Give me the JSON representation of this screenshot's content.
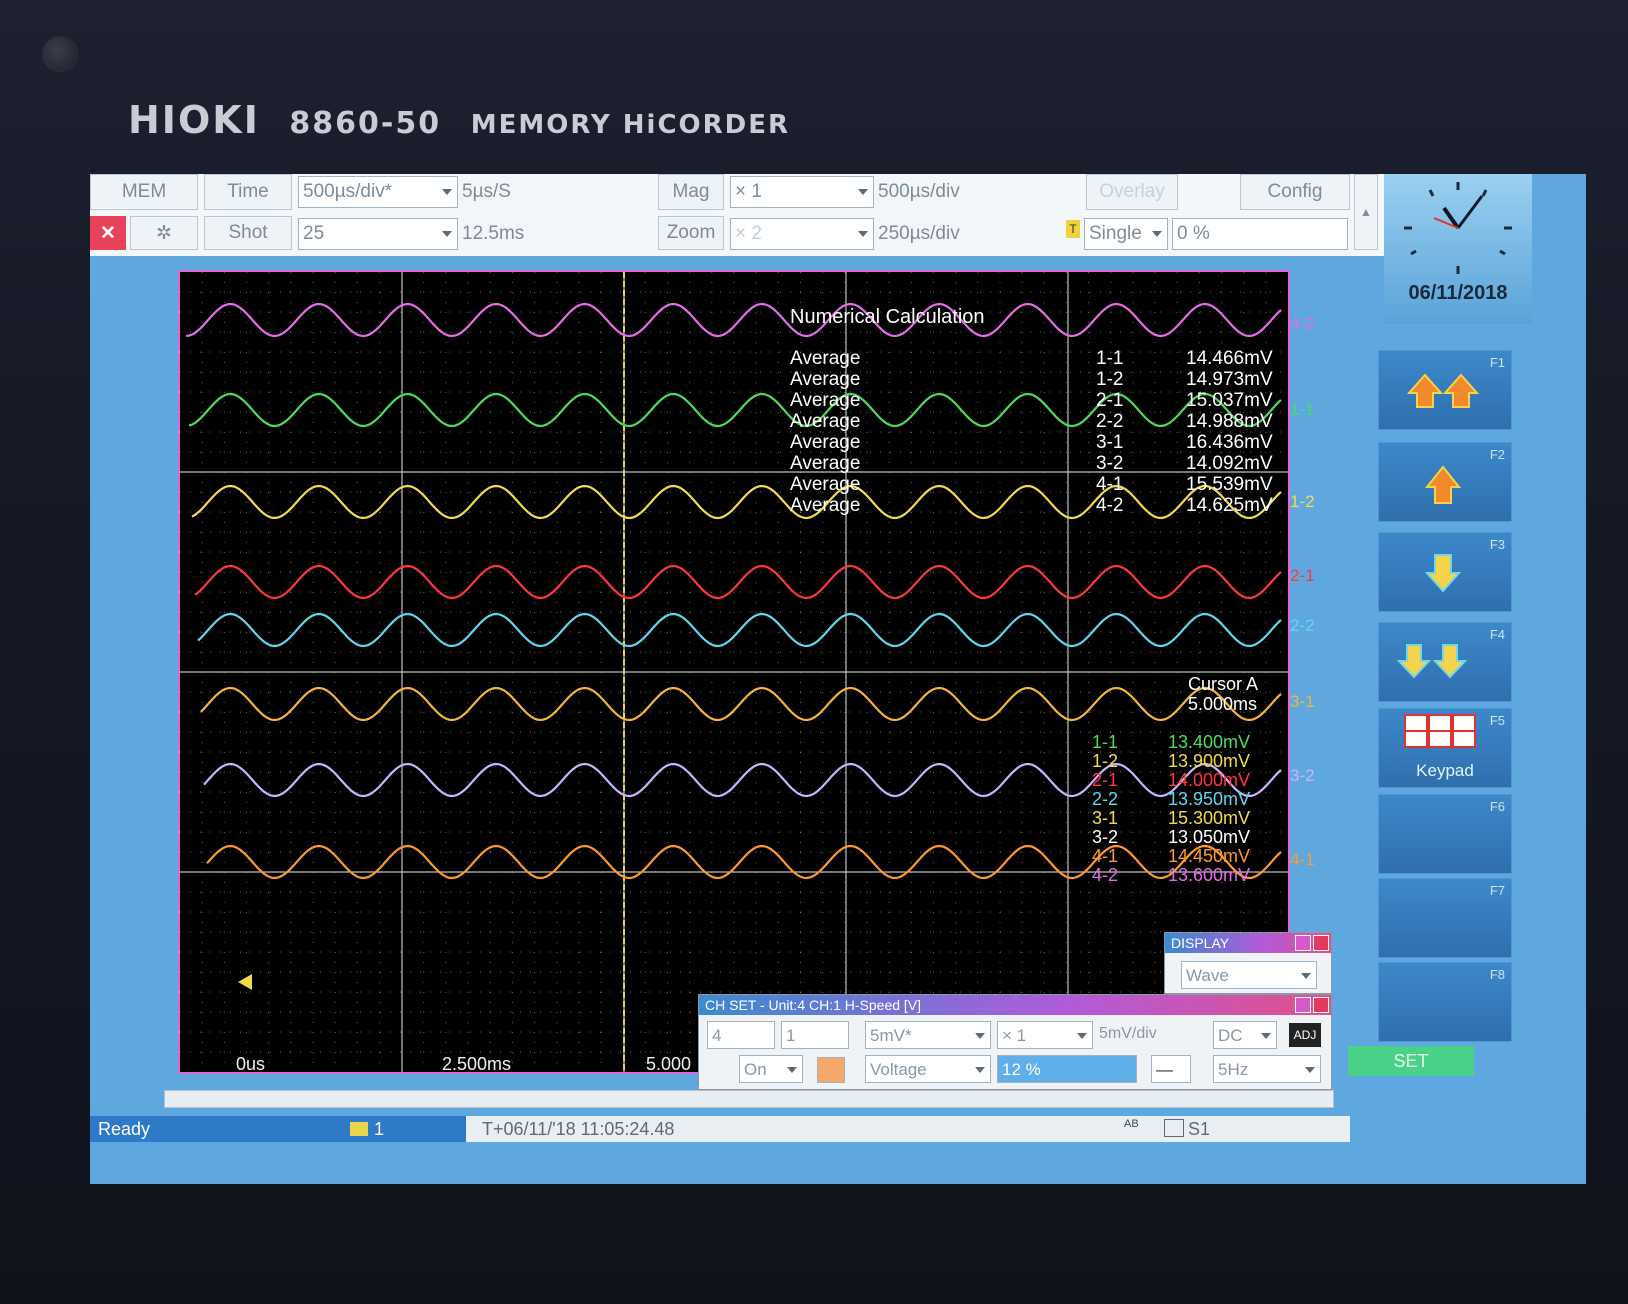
{
  "brand": {
    "name": "HIOKI",
    "model": "8860-50",
    "product": "MEMORY HiCORDER"
  },
  "toolbar": {
    "mem": "MEM",
    "time_label": "Time",
    "time_value": "500µs/div*",
    "sample_rate": "5µs/S",
    "mag_label": "Mag",
    "mag_value": "× 1",
    "mag_div": "500µs/div",
    "overlay": "Overlay",
    "config": "Config",
    "shot_label": "Shot",
    "shot_value": "25",
    "shot_length": "12.5ms",
    "zoom_label": "Zoom",
    "zoom_value": "× 2",
    "zoom_div": "250µs/div",
    "trigger_mode": "Single",
    "pretrigger": "0 %",
    "trigger_icon": "T"
  },
  "clock": {
    "date": "06/11/2018"
  },
  "fkeys": [
    {
      "label": "F1",
      "icon": "double-up-arrow-icon"
    },
    {
      "label": "F2",
      "icon": "up-arrow-icon"
    },
    {
      "label": "F3",
      "icon": "down-arrow-icon"
    },
    {
      "label": "F4",
      "icon": "double-down-arrow-icon"
    },
    {
      "label": "F5",
      "icon": "keypad-icon",
      "text": "Keypad",
      "digits": "456123"
    },
    {
      "label": "F6"
    },
    {
      "label": "F7"
    },
    {
      "label": "F8"
    }
  ],
  "set_button": "SET",
  "waveform_colors": {
    "ch_4_2": "#e56ee8",
    "ch_1_1": "#4fdc5a",
    "ch_1_2": "#f2dc4a",
    "ch_2_1": "#ff3838",
    "ch_2_2": "#5fd8f0",
    "ch_3_1": "#f5b43a",
    "ch_3_2": "#c6b6ff",
    "ch_4_1": "#ff9a2e",
    "cursor": "#e8d64a",
    "grid": "#bfbfbf",
    "frame": "#e36ad6"
  },
  "channel_tags": [
    "4-2",
    "1-1",
    "1-2",
    "2-1",
    "2-2",
    "3-1",
    "3-2",
    "4-1"
  ],
  "time_axis": [
    "0us",
    "2.500ms",
    "5.000"
  ],
  "numerical_calculation": {
    "title": "Numerical Calculation",
    "rows": [
      {
        "func": "Average",
        "ch": "1-1",
        "value": "14.466mV"
      },
      {
        "func": "Average",
        "ch": "1-2",
        "value": "14.973mV"
      },
      {
        "func": "Average",
        "ch": "2-1",
        "value": "15.037mV"
      },
      {
        "func": "Average",
        "ch": "2-2",
        "value": "14.988mV"
      },
      {
        "func": "Average",
        "ch": "3-1",
        "value": "16.436mV"
      },
      {
        "func": "Average",
        "ch": "3-2",
        "value": "14.092mV"
      },
      {
        "func": "Average",
        "ch": "4-1",
        "value": "15.539mV"
      },
      {
        "func": "Average",
        "ch": "4-2",
        "value": "14.625mV"
      }
    ]
  },
  "cursor": {
    "title": "Cursor A",
    "time": "5.000ms",
    "rows": [
      {
        "ch": "1-1",
        "value": "13.400mV",
        "color": "#4fdc5a"
      },
      {
        "ch": "1-2",
        "value": "13.900mV",
        "color": "#f2dc4a"
      },
      {
        "ch": "2-1",
        "value": "14.000mV",
        "color": "#ff3838"
      },
      {
        "ch": "2-2",
        "value": "13.950mV",
        "color": "#5fd8f0"
      },
      {
        "ch": "3-1",
        "value": "15.300mV",
        "color": "#f5dc4a"
      },
      {
        "ch": "3-2",
        "value": "13.050mV",
        "color": "#ffffff"
      },
      {
        "ch": "4-1",
        "value": "14.450mV",
        "color": "#ff9a2e"
      },
      {
        "ch": "4-2",
        "value": "13.600mV",
        "color": "#e56ee8"
      }
    ]
  },
  "display_dialog": {
    "title": "DISPLAY",
    "value": "Wave"
  },
  "chset_dialog": {
    "title": "CH SET - Unit:4 CH:1 H-Speed [V]",
    "unit": "4",
    "channel": "1",
    "range": "5mV*",
    "mag": "× 1",
    "range_div": "5mV/div",
    "coupling": "DC",
    "adj": "ADJ",
    "on": "On",
    "mode": "Voltage",
    "position": "12 %",
    "filter": "5Hz",
    "line": "—"
  },
  "status": {
    "text": "Ready",
    "shot_no": "1",
    "trigger_time": "T+06/11/'18 11:05:24.48",
    "cursor_mode": "S1",
    "ab": "AB"
  }
}
